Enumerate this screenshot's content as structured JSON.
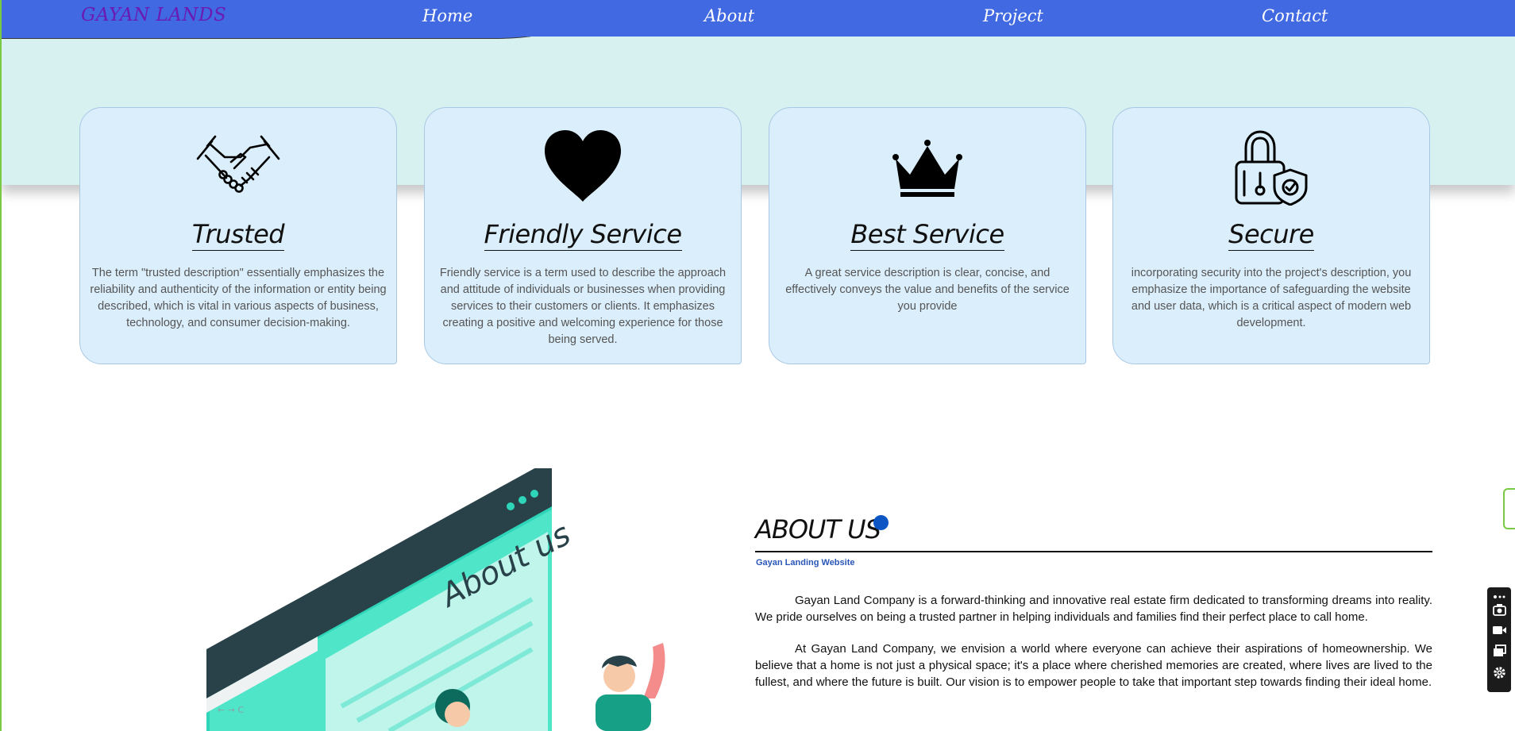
{
  "navbar": {
    "brand": "GAYAN LANDS",
    "links": [
      "Home",
      "About",
      "Project",
      "Contact"
    ],
    "background": "#4169e1",
    "brand_color": "#6a1bb3"
  },
  "features": [
    {
      "icon": "handshake-icon",
      "title": "Trusted",
      "description": "The term \"trusted description\" essentially emphasizes the reliability and authenticity of the information or entity being described, which is vital in various aspects of business, technology, and consumer decision-making."
    },
    {
      "icon": "heart-icon",
      "title": "Friendly Service",
      "description": "Friendly service is a term used to describe the approach and attitude of individuals or businesses when providing services to their customers or clients. It emphasizes creating a positive and welcoming experience for those being served."
    },
    {
      "icon": "crown-icon",
      "title": "Best Service",
      "description": "A great service description is clear, concise, and effectively conveys the value and benefits of the service you provide"
    },
    {
      "icon": "lock-shield-icon",
      "title": "Secure",
      "description": "incorporating security into the project's description, you emphasize the importance of safeguarding the website and user data, which is a critical aspect of modern web development."
    }
  ],
  "about": {
    "illustration_text": "About us",
    "title": "ABOUT US",
    "subtitle": "Gayan Landing Website",
    "paragraphs": [
      "Gayan Land Company is a forward-thinking and innovative real estate firm dedicated to transforming dreams into reality. We pride ourselves on being a trusted partner in helping individuals and families find their perfect place to call home.",
      "At Gayan Land Company, we envision a world where everyone can achieve their aspirations of homeownership. We believe that a home is not just a physical space; it's a place where cherished memories are created, where lives are lived to the fullest, and where the future is built. Our vision is to empower people to take that important step towards finding their ideal home."
    ],
    "accent_color": "#0b55c4"
  }
}
